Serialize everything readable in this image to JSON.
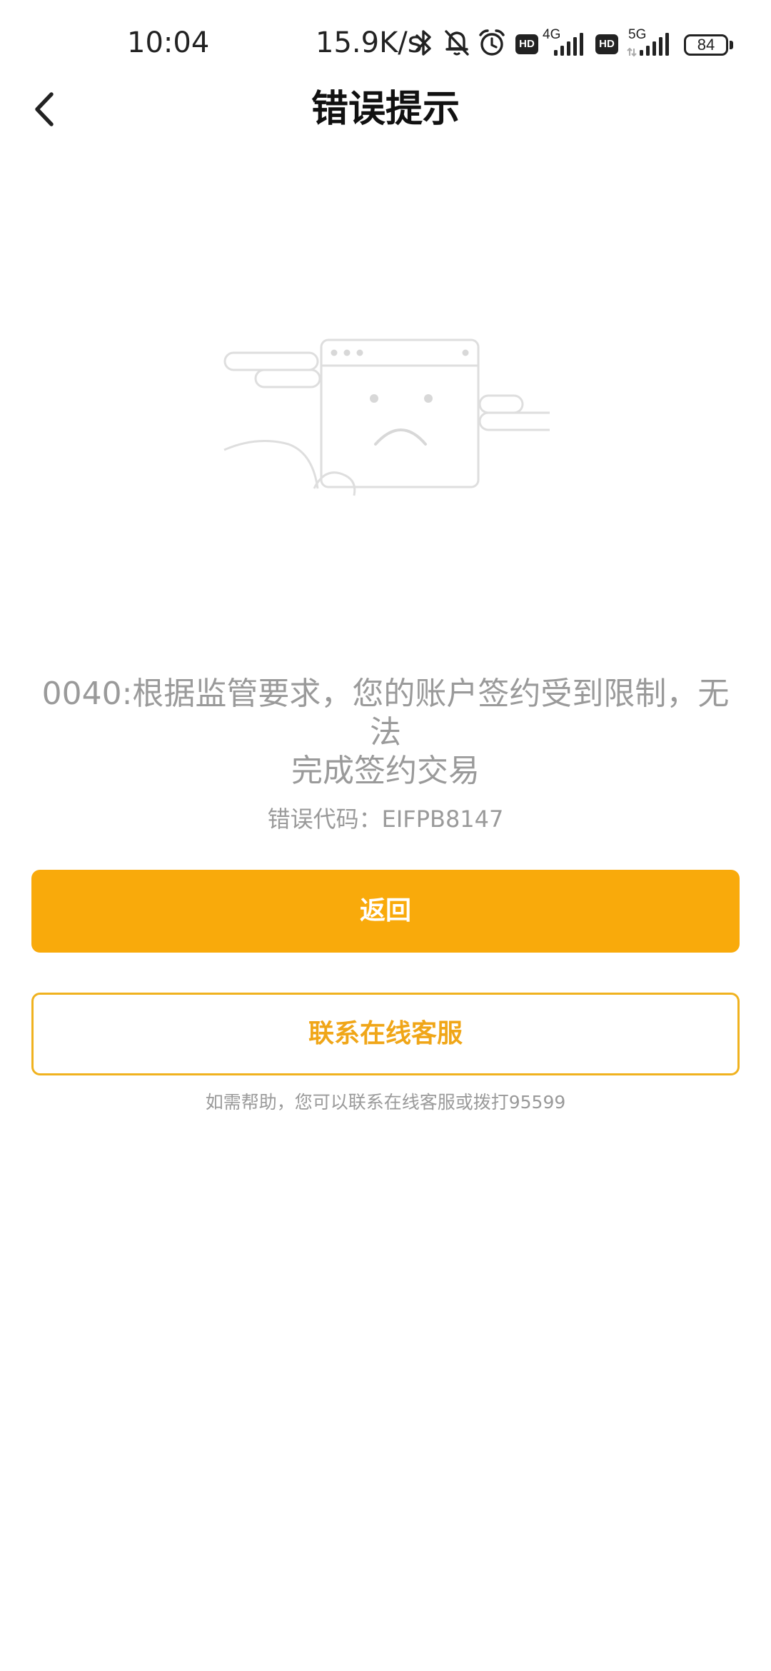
{
  "status_bar": {
    "time": "10:04",
    "net_speed": "15.9K/s",
    "icons": [
      "bluetooth-icon",
      "mute-bell-icon",
      "alarm-icon",
      "hd-icon",
      "signal-4g-icon",
      "hd-icon",
      "signal-5g-icon"
    ],
    "hd_label": "HD",
    "net_4g": "4G",
    "net_5g": "5G",
    "battery": "84"
  },
  "nav": {
    "title": "错误提示",
    "back_icon": "chevron-left-icon"
  },
  "illustration": {
    "icon": "sad-browser-window-icon"
  },
  "error": {
    "message": "0040:根据监管要求，您的账户签约受到限制，无法\n完成签约交易",
    "code_label": "错误代码：",
    "code_value": "EIFPB8147"
  },
  "buttons": {
    "back_label": "返回",
    "contact_label": "联系在线客服"
  },
  "help_text": "如需帮助，您可以联系在线客服或拨打95599",
  "colors": {
    "primary": "#f9aa0b",
    "secondary_border": "#f0b21f",
    "muted_text": "#9a9a9a"
  }
}
